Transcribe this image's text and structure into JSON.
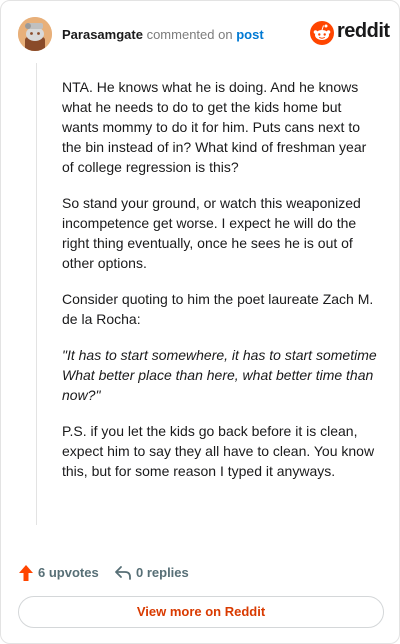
{
  "header": {
    "author": "Parasamgate",
    "action_text": "commented on",
    "post_link": "post",
    "brand_name": "reddit",
    "brand_color": "#ff4500",
    "avatar_icon": "snoo-avatar-icon"
  },
  "comment": {
    "paragraphs": [
      "NTA. He knows what he is doing. And he knows what he needs to do to get the kids home but wants mommy to do it for him. Puts cans next to the bin instead of in? What kind of freshman year of college regression is this?",
      "So stand your ground, or watch this weaponized incompetence get worse. I expect he will do the right thing eventually, once he sees he is out of other options.",
      "Consider quoting to him the poet laureate Zach M. de la Rocha:"
    ],
    "quote_line1": "\"It has to start somewhere, it has to start sometime",
    "quote_line2": "What better place than here, what better time than now?\"",
    "closing": "P.S. if you let the kids go back before it is clean, expect him to say they all have to clean. You know this, but for some reason I typed it anyways."
  },
  "actions": {
    "upvotes_label": "6 upvotes",
    "replies_label": "0 replies",
    "upvote_color": "#ff4500",
    "upvote_icon": "upvote-arrow-icon",
    "reply_icon": "reply-arrow-icon"
  },
  "footer": {
    "view_more_label": "View more on Reddit",
    "view_more_color": "#d93a00"
  }
}
